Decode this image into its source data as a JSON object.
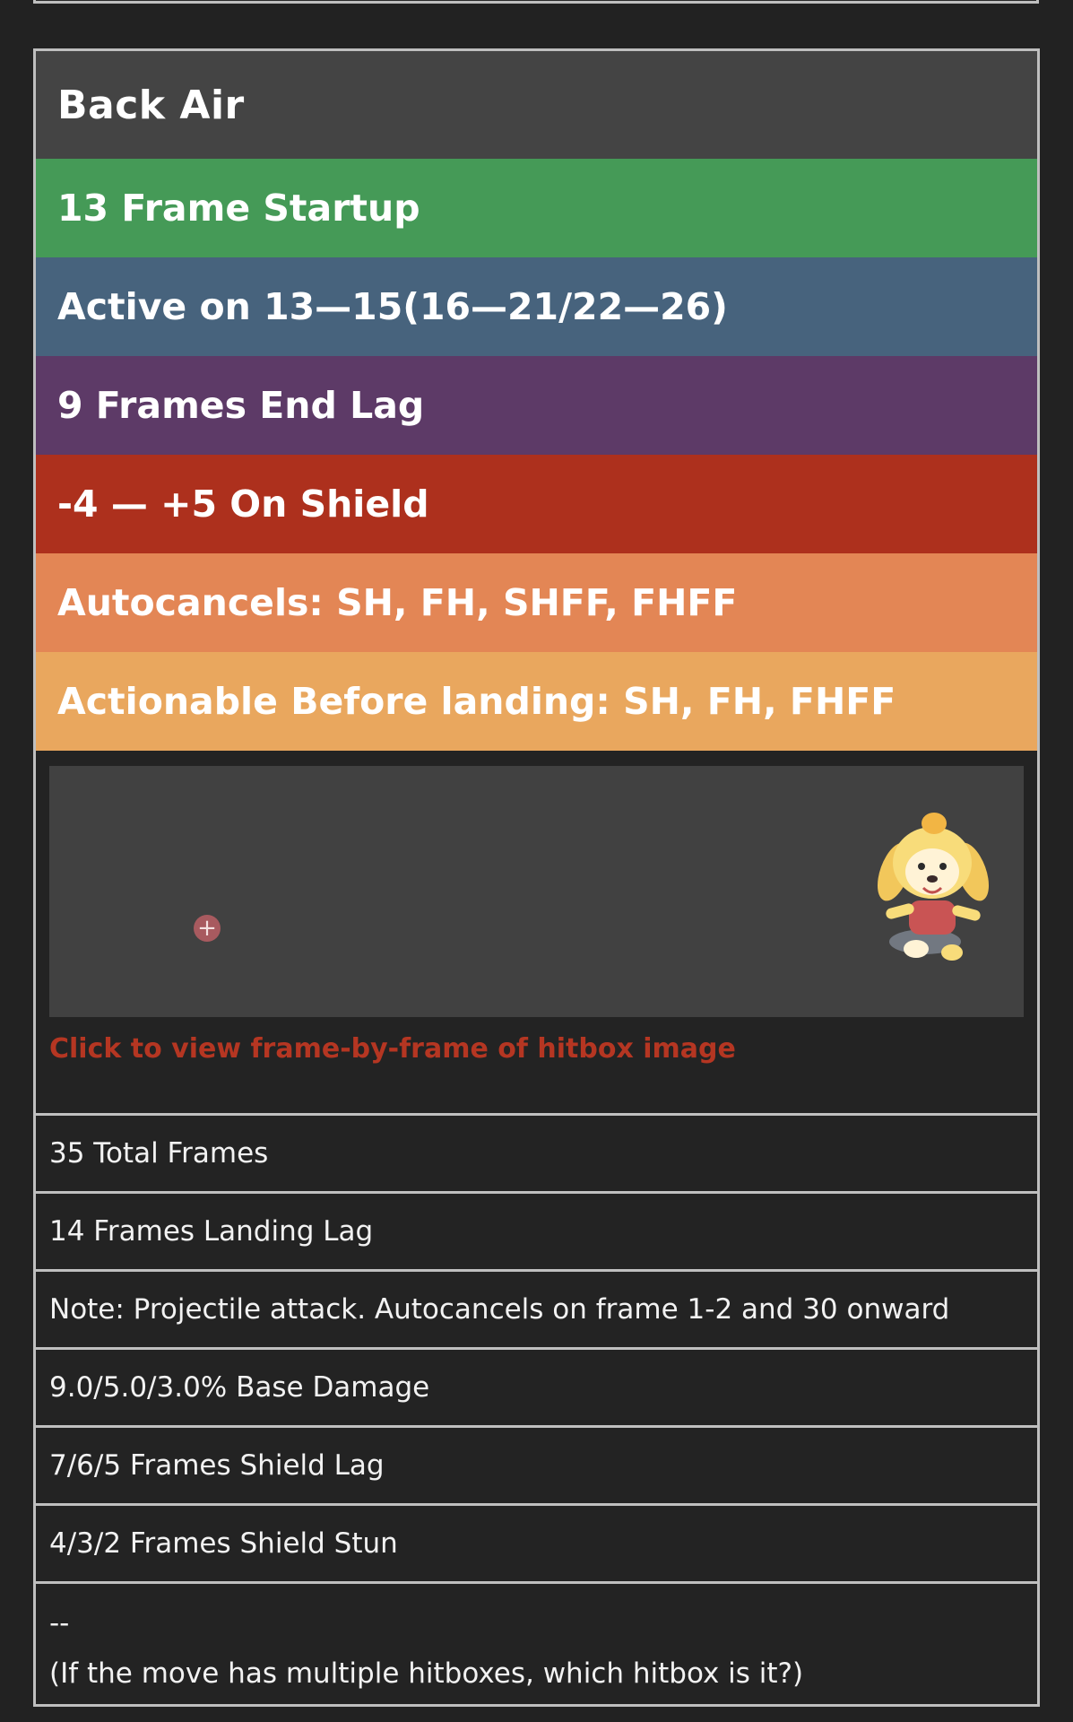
{
  "move": {
    "title": "Back Air",
    "bands": [
      {
        "text": "13 Frame Startup",
        "color": "#459a57"
      },
      {
        "text": "Active on 13—15(16—21/22—26)",
        "color": "#47637d"
      },
      {
        "text": "9 Frames End Lag",
        "color": "#5d3a67"
      },
      {
        "text": "-4 — +5 On Shield",
        "color": "#ad301d"
      },
      {
        "text": "Autocancels: SH, FH, SHFF, FHFF",
        "color": "#e38655"
      },
      {
        "text": "Actionable Before landing: SH, FH, FHFF",
        "color": "#e9a75e"
      }
    ],
    "hitbox_image": {
      "plus_glyph": "+",
      "sprite_icon": "isabelle-character-icon",
      "caption": "Click to view frame-by-frame of hitbox image"
    },
    "stats": [
      "35 Total Frames",
      "14 Frames Landing Lag",
      "Note: Projectile attack. Autocancels on frame 1-2 and 30 onward",
      "9.0/5.0/3.0% Base Damage",
      "7/6/5 Frames Shield Lag",
      "4/3/2 Frames Shield Stun"
    ],
    "hitbox_note": {
      "dashes": "--",
      "text": "(If the move has multiple hitboxes, which hitbox is it?)"
    }
  }
}
